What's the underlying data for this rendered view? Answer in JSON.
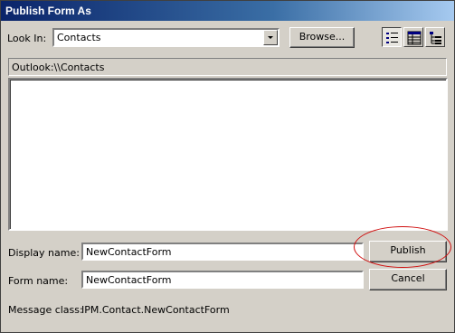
{
  "window": {
    "title": "Publish Form As"
  },
  "look_in": {
    "label": "Look In:",
    "value": "Contacts"
  },
  "browse_label": "Browse...",
  "view_buttons": [
    "list-view-icon",
    "details-view-icon",
    "tree-view-icon"
  ],
  "path": "Outlook:\\\\Contacts",
  "display_name": {
    "label": "Display name:",
    "value": "NewContactForm"
  },
  "form_name": {
    "label": "Form name:",
    "value": "NewContactForm"
  },
  "message_class": {
    "label": "Message class:",
    "value": "IPM.Contact.NewContactForm"
  },
  "buttons": {
    "publish": "Publish",
    "cancel": "Cancel"
  },
  "colors": {
    "title_start": "#0a246a",
    "title_end": "#a6caf0",
    "highlight_ring": "#d01010",
    "face": "#d4d0c8"
  }
}
